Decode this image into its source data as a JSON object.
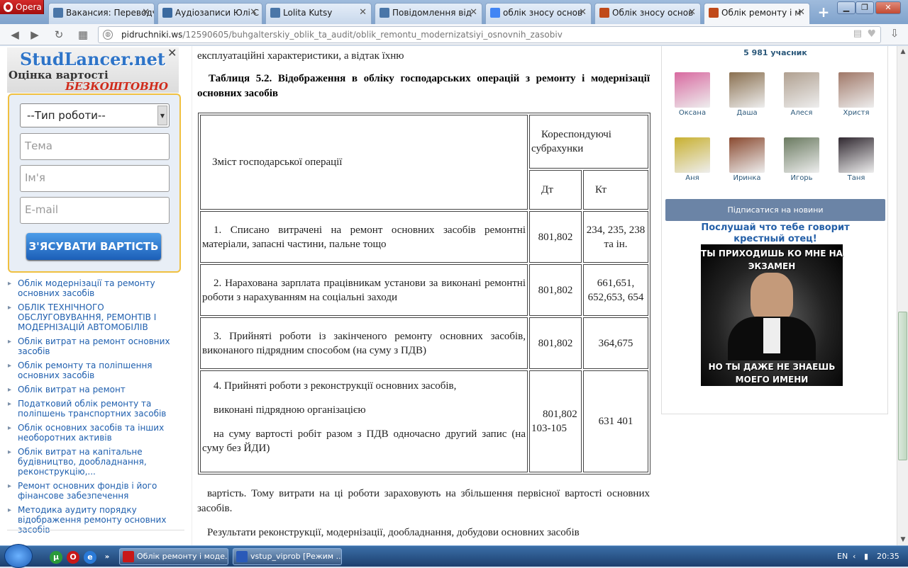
{
  "browser": {
    "menu_label": "Opera",
    "tabs": [
      {
        "label": "Вакансия: Переводч",
        "icon": "vk-icon",
        "color": "#4a76a8"
      },
      {
        "label": "Аудіозаписи Юлі С",
        "icon": "video-icon",
        "color": "#3b6aa0"
      },
      {
        "label": "Lolita Kutsy",
        "icon": "vk-icon",
        "color": "#4a76a8"
      },
      {
        "label": "Повідомлення від",
        "icon": "vk-icon",
        "color": "#4a76a8"
      },
      {
        "label": "облік зносу основ",
        "icon": "google-icon",
        "color": "#4285f4"
      },
      {
        "label": "Облік зносу основ",
        "icon": "book-icon",
        "color": "#c04a1a"
      },
      {
        "label": "Облік ремонту і м",
        "icon": "book-icon",
        "color": "#c04a1a"
      }
    ],
    "active_tab": 6,
    "url_domain": "pidruchniki.ws",
    "url_path": "/12590605/buhgalterskiy_oblik_ta_audit/oblik_remontu_modernizatsiyi_osnovnih_zasobiv"
  },
  "ad": {
    "brand": "StudLancer.net",
    "line1": "Оцінка вартості",
    "line2": "БЕЗКОШТОВНО",
    "select_value": "--Тип роботи--",
    "topic_placeholder": "Тема",
    "name_placeholder": "Ім'я",
    "email_placeholder": "E-mail",
    "button": "З'ЯСУВАТИ ВАРТІСТЬ"
  },
  "left_links": [
    "Облік модернізації та ремонту основних засобів",
    "ОБЛІК ТЕХНІЧНОГО ОБСЛУГОВУВАННЯ, РЕМОНТІВ І МОДЕРНІЗАЦІЙ АВТОМОБІЛІВ",
    "Облік витрат на ремонт основних засобів",
    "Облік ремонту та поліпшення основних засобів",
    "Облік витрат на ремонт",
    "Податковий облік ремонту та поліпшень транспортних засобів",
    "Облік основних засобів та інших необоротних активів",
    "Облік витрат на капітальне будівництво, дообладнання, реконструкцію,...",
    "Ремонт основних фондів і його фінансове забезпечення",
    "Методика аудиту порядку відображення ремонту основних засобів"
  ],
  "article": {
    "intro": "експлуатаційні характеристики, а відтак їхню",
    "caption": "Таблиця 5.2. Відображення в обліку господарських операцій з ремонту і модернізації основних засобів",
    "table_header": {
      "content": "Зміст господарської операції",
      "corr": "Кореспондуючі субрахунки",
      "dt": "Дт",
      "kt": "Кт"
    },
    "rows": [
      {
        "text": "1. Списано витрачені на ремонт основних засобів ремонтні матеріали, запасні частини, пальне тощо",
        "dt": "801,802",
        "kt": "234, 235, 238 та ін."
      },
      {
        "text": "2. Нарахована зарплата працівникам установи за виконані ремонтні роботи з нарахуванням на соціальні заходи",
        "dt": "801,802",
        "kt": "661,651, 652,653, 654"
      },
      {
        "text": "3. Прийняті роботи із закінченого ремонту основних засобів, виконаного підрядним способом (на суму з ПДВ)",
        "dt": "801,802",
        "kt": "364,675"
      }
    ],
    "row4": {
      "line1": "4. Прийняті роботи з реконструкції основних засобів,",
      "line2": "виконані підрядною організацією",
      "line3": "на суму вартості робіт разом з ПДВ одночасно другий запис (на суму без ЙДИ)",
      "dt": "801,802 103-105",
      "kt": "631 401"
    },
    "after1": "вартість. Тому витрати на ці роботи зараховують на збільшення первісної вартості основних засобів.",
    "after2": "Результати реконструкції, модернізації, дообладнання, добудови основних засобів"
  },
  "community": {
    "members": "5 981 учасник",
    "people": [
      {
        "name": "Оксана",
        "color": "#d86aa0"
      },
      {
        "name": "Даша",
        "color": "#8a7050"
      },
      {
        "name": "Алеся",
        "color": "#b0a090"
      },
      {
        "name": "Христя",
        "color": "#a07868"
      },
      {
        "name": "Аня",
        "color": "#c8b030"
      },
      {
        "name": "Иринка",
        "color": "#8a4a30"
      },
      {
        "name": "Игорь",
        "color": "#6a7a60"
      },
      {
        "name": "Таня",
        "color": "#302830"
      }
    ],
    "subscribe": "Підписатися на новини",
    "promo": "Послушай что тебе говорит крестный отец!",
    "meme_top": "ТЫ ПРИХОДИШЬ КО МНЕ НА ЭКЗАМЕН",
    "meme_bottom": "НО ТЫ ДАЖЕ НЕ ЗНАЕШЬ МОЕГО ИМЕНИ"
  },
  "taskbar": {
    "items": [
      {
        "label": "Облік ремонту і моде...",
        "icon": "opera-icon",
        "color": "#c81818"
      },
      {
        "label": "vstup_viprob [Режим ...",
        "icon": "word-icon",
        "color": "#2a5ab8"
      }
    ],
    "lang": "EN",
    "time": "20:35"
  }
}
